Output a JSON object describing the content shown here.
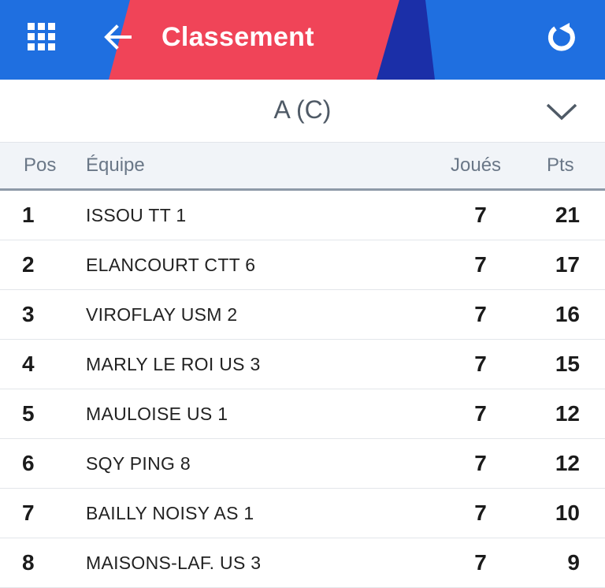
{
  "header": {
    "title": "Classement",
    "colors": {
      "blue": "#1f6fe0",
      "red": "#f04458",
      "navy": "#1b2fa8"
    },
    "icons": {
      "menu": "grid-icon",
      "back": "arrow-left-icon",
      "refresh": "refresh-icon"
    }
  },
  "selector": {
    "value": "A (C)",
    "icon": "chevron-down-icon"
  },
  "table": {
    "columns": {
      "pos": "Pos",
      "team": "Équipe",
      "played": "Joués",
      "points": "Pts"
    },
    "rows": [
      {
        "pos": "1",
        "team": "ISSOU TT 1",
        "played": "7",
        "points": "21"
      },
      {
        "pos": "2",
        "team": "ELANCOURT CTT 6",
        "played": "7",
        "points": "17"
      },
      {
        "pos": "3",
        "team": "VIROFLAY USM 2",
        "played": "7",
        "points": "16"
      },
      {
        "pos": "4",
        "team": "MARLY LE ROI US 3",
        "played": "7",
        "points": "15"
      },
      {
        "pos": "5",
        "team": "MAULOISE US 1",
        "played": "7",
        "points": "12"
      },
      {
        "pos": "6",
        "team": "SQY PING 8",
        "played": "7",
        "points": "12"
      },
      {
        "pos": "7",
        "team": "BAILLY NOISY AS 1",
        "played": "7",
        "points": "10"
      },
      {
        "pos": "8",
        "team": "MAISONS-LAF. US 3",
        "played": "7",
        "points": "9"
      }
    ]
  }
}
